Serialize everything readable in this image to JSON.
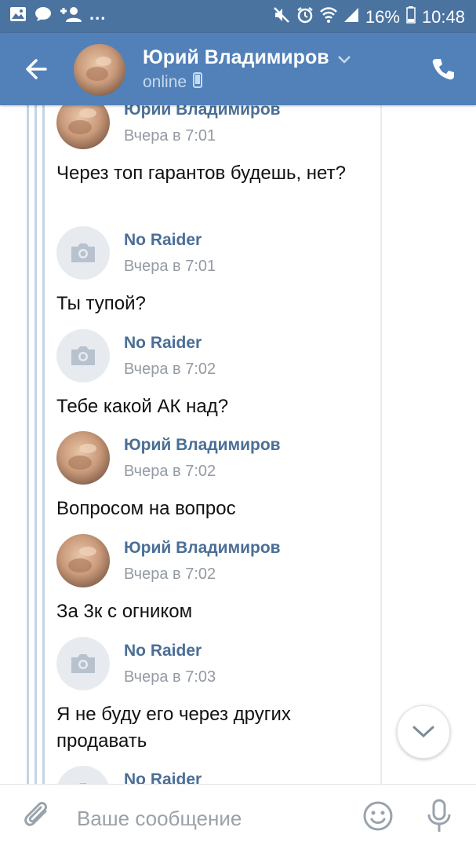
{
  "status_bar": {
    "more": "...",
    "battery": "16%",
    "time": "10:48"
  },
  "header": {
    "name": "Юрий Владимиров",
    "status": "online"
  },
  "messages": [
    {
      "sender": "Юрий Владимиров",
      "time": "Вчера в 7:01",
      "text": "Через топ гарантов будешь, нет?",
      "avatar": "photo"
    },
    {
      "sender": "No Raider",
      "time": "Вчера в 7:01",
      "text": "Ты тупой?",
      "avatar": "placeholder"
    },
    {
      "sender": "No Raider",
      "time": "Вчера в 7:02",
      "text": "Тебе какой АК над?",
      "avatar": "placeholder"
    },
    {
      "sender": "Юрий Владимиров",
      "time": "Вчера в 7:02",
      "text": "Вопросом на вопрос",
      "avatar": "photo"
    },
    {
      "sender": "Юрий Владимиров",
      "time": "Вчера в 7:02",
      "text": "За 3к с огником",
      "avatar": "photo"
    },
    {
      "sender": "No Raider",
      "time": "Вчера в 7:03",
      "text": "Я не буду его через других продавать",
      "avatar": "placeholder"
    },
    {
      "sender": "No Raider",
      "time": "",
      "text": "",
      "avatar": "placeholder"
    }
  ],
  "composer": {
    "placeholder": "Ваше сообщение"
  },
  "colors": {
    "header_bg": "#5181b8",
    "status_bar_bg": "#4a73a0",
    "sender_name": "#4a6e96",
    "timestamp": "#939aa3"
  }
}
